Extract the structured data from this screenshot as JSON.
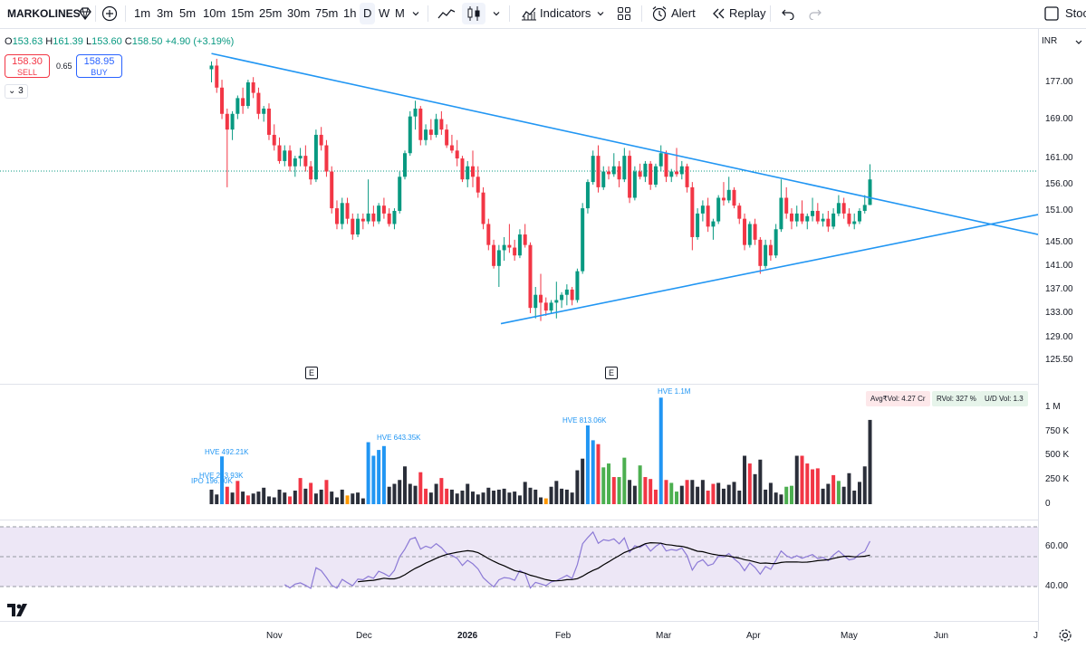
{
  "toolbar": {
    "symbol": "MARKOLINES",
    "timeframes": [
      "1m",
      "3m",
      "5m",
      "10m",
      "15m",
      "25m",
      "30m",
      "75m",
      "1h",
      "D",
      "W",
      "M"
    ],
    "active_timeframe": "D",
    "indicators_label": "Indicators",
    "alert_label": "Alert",
    "replay_label": "Replay",
    "right_label": "Stoc"
  },
  "legend": {
    "o_label": "O",
    "o_value": "153.63",
    "h_label": "H",
    "h_value": "161.39",
    "l_label": "L",
    "l_value": "153.60",
    "c_label": "C",
    "c_value": "158.50",
    "change": "+4.90 (+3.19%)"
  },
  "trade": {
    "sell_price": "158.30",
    "sell_label": "SELL",
    "spread": "0.65",
    "buy_price": "158.95",
    "buy_label": "BUY"
  },
  "indicator_count": "3",
  "currency": "INR",
  "price_axis": {
    "ticks": [
      "177.00",
      "169.00",
      "161.00",
      "156.00",
      "151.00",
      "145.00",
      "141.00",
      "137.00",
      "133.00",
      "129.00",
      "125.50"
    ]
  },
  "volume_axis": {
    "ticks": [
      "1 M",
      "750 K",
      "500 K",
      "250 K",
      "0"
    ]
  },
  "rsi_axis": {
    "ticks": [
      "60.00",
      "40.00"
    ]
  },
  "time_axis": {
    "labels": [
      "Nov",
      "Dec",
      "2026",
      "Feb",
      "Mar",
      "Apr",
      "May",
      "Jun",
      "J"
    ]
  },
  "earnings_marker": "E",
  "volume_tags": {
    "avg": "Avg₹Vol: 4.27 Cr",
    "rvol": "RVol: 327 %",
    "ud": "U/D Vol: 1.3"
  },
  "volume_annotations": [
    "HVE 492.21K",
    "HVE 243.93K",
    "IPO 196.60K",
    "HVE 643.35K",
    "HVE 813.06K",
    "HVE 1.1M"
  ],
  "colors": {
    "up": "#089981",
    "down": "#f23645",
    "trendline": "#2196f3",
    "vol_dark": "#2a2e39",
    "vol_blue": "#2196f3",
    "vol_green": "#4caf50",
    "vol_red": "#f23645",
    "rsi": "#8c7ad6",
    "rsi_ma": "#000000",
    "rsi_band": "#ede7f6"
  },
  "chart_data": {
    "type": "candlestick",
    "instrument": "MARKOLINES",
    "interval": "D",
    "ylim": [
      124,
      183
    ],
    "candles": [
      [
        179.5,
        181.0,
        177.0,
        180.2
      ],
      [
        180.2,
        181.5,
        175.0,
        176.0
      ],
      [
        176.0,
        177.5,
        170.0,
        171.0
      ],
      [
        171.0,
        172.0,
        157.0,
        168.0
      ],
      [
        168.0,
        171.5,
        166.0,
        171.0
      ],
      [
        171.0,
        174.5,
        170.0,
        174.0
      ],
      [
        174.0,
        176.0,
        171.0,
        172.5
      ],
      [
        172.5,
        177.5,
        172.0,
        177.0
      ],
      [
        177.0,
        178.0,
        174.0,
        175.0
      ],
      [
        175.0,
        176.0,
        170.0,
        171.0
      ],
      [
        171.0,
        172.5,
        169.5,
        172.0
      ],
      [
        172.0,
        173.0,
        166.0,
        167.0
      ],
      [
        167.0,
        169.0,
        164.0,
        165.0
      ],
      [
        165.0,
        166.5,
        161.5,
        162.0
      ],
      [
        162.0,
        165.0,
        161.0,
        164.0
      ],
      [
        164.0,
        165.0,
        160.0,
        161.0
      ],
      [
        161.0,
        163.0,
        159.0,
        162.5
      ],
      [
        162.5,
        164.5,
        161.0,
        163.0
      ],
      [
        163.0,
        165.0,
        160.0,
        161.0
      ],
      [
        161.0,
        162.0,
        157.5,
        158.5
      ],
      [
        158.5,
        168.0,
        158.0,
        167.0
      ],
      [
        167.0,
        168.5,
        164.0,
        165.0
      ],
      [
        165.0,
        166.0,
        159.0,
        160.0
      ],
      [
        160.0,
        161.0,
        152.0,
        153.0
      ],
      [
        153.0,
        154.5,
        149.0,
        150.0
      ],
      [
        150.0,
        155.0,
        149.0,
        154.0
      ],
      [
        154.0,
        155.0,
        150.0,
        151.0
      ],
      [
        151.0,
        152.0,
        147.0,
        148.0
      ],
      [
        148.0,
        152.0,
        147.5,
        151.0
      ],
      [
        151.0,
        152.0,
        149.0,
        150.5
      ],
      [
        150.5,
        158.5,
        150.0,
        152.0
      ],
      [
        152.0,
        153.5,
        149.5,
        150.5
      ],
      [
        150.5,
        154.0,
        150.0,
        153.5
      ],
      [
        153.5,
        155.0,
        151.0,
        152.0
      ],
      [
        152.0,
        153.0,
        149.5,
        150.0
      ],
      [
        150.0,
        153.0,
        149.0,
        152.5
      ],
      [
        152.5,
        160.0,
        152.0,
        159.0
      ],
      [
        159.0,
        164.0,
        158.5,
        163.5
      ],
      [
        163.5,
        171.5,
        163.0,
        170.5
      ],
      [
        170.5,
        173.5,
        168.0,
        172.0
      ],
      [
        172.0,
        172.5,
        165.0,
        166.0
      ],
      [
        166.0,
        169.0,
        165.0,
        168.0
      ],
      [
        168.0,
        170.0,
        166.0,
        167.0
      ],
      [
        167.0,
        171.0,
        166.5,
        170.0
      ],
      [
        170.0,
        171.5,
        167.0,
        168.0
      ],
      [
        168.0,
        169.0,
        164.5,
        165.0
      ],
      [
        165.0,
        167.0,
        163.5,
        164.0
      ],
      [
        164.0,
        166.0,
        161.0,
        162.5
      ],
      [
        162.5,
        163.0,
        158.0,
        158.5
      ],
      [
        158.5,
        162.0,
        157.0,
        161.0
      ],
      [
        161.0,
        164.0,
        157.0,
        159.0
      ],
      [
        159.0,
        161.0,
        155.0,
        156.0
      ],
      [
        156.0,
        157.0,
        149.0,
        150.0
      ],
      [
        150.0,
        151.0,
        145.0,
        146.0
      ],
      [
        146.0,
        147.0,
        141.5,
        142.0
      ],
      [
        142.0,
        146.0,
        138.0,
        145.0
      ],
      [
        145.0,
        147.5,
        143.0,
        146.0
      ],
      [
        146.0,
        150.0,
        144.5,
        145.5
      ],
      [
        145.5,
        147.0,
        143.0,
        144.0
      ],
      [
        144.0,
        149.0,
        143.5,
        148.0
      ],
      [
        148.0,
        150.0,
        145.5,
        146.0
      ],
      [
        146.0,
        146.5,
        133.0,
        134.0
      ],
      [
        134.0,
        138.0,
        132.0,
        136.5
      ],
      [
        136.5,
        140.5,
        131.5,
        135.0
      ],
      [
        135.0,
        136.0,
        132.5,
        133.5
      ],
      [
        133.5,
        135.5,
        133.0,
        135.0
      ],
      [
        135.0,
        139.0,
        132.0,
        135.5
      ],
      [
        135.5,
        137.0,
        134.0,
        136.5
      ],
      [
        136.5,
        138.5,
        134.5,
        137.5
      ],
      [
        137.5,
        138.0,
        134.5,
        135.5
      ],
      [
        135.5,
        141.5,
        135.0,
        141.0
      ],
      [
        141.0,
        154.0,
        140.5,
        153.0
      ],
      [
        153.0,
        158.5,
        152.0,
        158.0
      ],
      [
        158.0,
        164.0,
        157.5,
        163.0
      ],
      [
        163.0,
        165.0,
        156.0,
        157.0
      ],
      [
        157.0,
        161.0,
        156.5,
        160.0
      ],
      [
        160.0,
        161.0,
        158.5,
        159.5
      ],
      [
        159.5,
        163.5,
        159.0,
        161.0
      ],
      [
        161.0,
        162.0,
        157.0,
        158.5
      ],
      [
        158.5,
        164.5,
        158.0,
        163.0
      ],
      [
        163.0,
        164.0,
        154.0,
        155.0
      ],
      [
        155.0,
        161.0,
        154.5,
        160.0
      ],
      [
        160.0,
        161.5,
        158.5,
        159.0
      ],
      [
        159.0,
        162.0,
        158.0,
        161.5
      ],
      [
        161.5,
        162.0,
        156.5,
        157.5
      ],
      [
        157.5,
        161.5,
        157.0,
        161.0
      ],
      [
        161.0,
        165.0,
        160.0,
        163.5
      ],
      [
        163.5,
        164.0,
        158.0,
        159.0
      ],
      [
        159.0,
        160.5,
        158.0,
        160.0
      ],
      [
        160.0,
        164.5,
        159.0,
        159.5
      ],
      [
        159.5,
        162.0,
        158.5,
        161.0
      ],
      [
        161.0,
        161.5,
        156.0,
        157.0
      ],
      [
        157.0,
        158.0,
        145.0,
        147.5
      ],
      [
        147.5,
        153.0,
        147.0,
        152.0
      ],
      [
        152.0,
        154.5,
        150.5,
        153.5
      ],
      [
        153.5,
        155.0,
        148.5,
        149.5
      ],
      [
        149.5,
        151.0,
        147.0,
        150.5
      ],
      [
        150.5,
        155.5,
        150.0,
        155.0
      ],
      [
        155.0,
        158.0,
        153.5,
        154.5
      ],
      [
        154.5,
        159.0,
        154.0,
        156.5
      ],
      [
        156.5,
        157.0,
        153.0,
        153.5
      ],
      [
        153.5,
        154.0,
        150.0,
        151.0
      ],
      [
        151.0,
        152.0,
        145.0,
        146.0
      ],
      [
        146.0,
        150.5,
        145.5,
        150.0
      ],
      [
        150.0,
        151.0,
        146.0,
        147.0
      ],
      [
        147.0,
        147.5,
        140.5,
        142.0
      ],
      [
        142.0,
        147.0,
        141.5,
        146.0
      ],
      [
        146.0,
        147.0,
        143.0,
        144.0
      ],
      [
        144.0,
        150.0,
        143.5,
        149.0
      ],
      [
        149.0,
        158.5,
        148.5,
        155.0
      ],
      [
        155.0,
        157.0,
        151.0,
        152.0
      ],
      [
        152.0,
        153.0,
        149.0,
        150.5
      ],
      [
        150.5,
        153.5,
        149.5,
        152.0
      ],
      [
        152.0,
        154.5,
        150.0,
        150.5
      ],
      [
        150.5,
        152.0,
        149.0,
        151.5
      ],
      [
        151.5,
        155.0,
        150.5,
        152.5
      ],
      [
        152.5,
        154.0,
        150.0,
        150.5
      ],
      [
        150.5,
        152.0,
        149.5,
        151.0
      ],
      [
        151.0,
        152.5,
        148.5,
        149.5
      ],
      [
        149.5,
        153.0,
        149.0,
        152.0
      ],
      [
        152.0,
        155.5,
        151.5,
        154.0
      ],
      [
        154.0,
        155.0,
        151.0,
        152.0
      ],
      [
        152.0,
        153.0,
        149.5,
        150.0
      ],
      [
        150.0,
        152.0,
        149.0,
        150.5
      ],
      [
        150.5,
        153.0,
        150.0,
        152.5
      ],
      [
        152.5,
        155.5,
        152.0,
        153.63
      ],
      [
        153.63,
        161.39,
        153.6,
        158.5
      ]
    ],
    "volume_k": [
      150,
      100,
      493,
      180,
      120,
      240,
      130,
      90,
      110,
      130,
      170,
      80,
      70,
      150,
      120,
      80,
      140,
      270,
      160,
      220,
      110,
      150,
      250,
      130,
      70,
      150,
      90,
      110,
      120,
      60,
      640,
      500,
      560,
      600,
      180,
      210,
      250,
      390,
      210,
      190,
      330,
      160,
      120,
      210,
      270,
      160,
      150,
      110,
      140,
      210,
      130,
      100,
      120,
      170,
      140,
      150,
      160,
      120,
      130,
      90,
      230,
      170,
      150,
      70,
      60,
      180,
      240,
      160,
      150,
      120,
      350,
      470,
      813,
      660,
      620,
      380,
      420,
      280,
      280,
      480,
      250,
      190,
      400,
      280,
      260,
      150,
      1100,
      250,
      220,
      130,
      190,
      250,
      250,
      180,
      250,
      140,
      210,
      220,
      160,
      200,
      230,
      140,
      500,
      420,
      310,
      460,
      150,
      220,
      120,
      100,
      180,
      190,
      500,
      500,
      420,
      360,
      370,
      160,
      210,
      300,
      240,
      180,
      320,
      140,
      230,
      390,
      870
    ],
    "volume_colors": "per-bar: dark / blue (high-volume) / green / red / orange",
    "rsi_ylim": [
      25,
      75
    ],
    "rsi_levels": [
      70,
      50,
      30
    ],
    "trendlines": [
      {
        "name": "upper",
        "from": {
          "bar": 0,
          "price": 182.5
        },
        "to": {
          "bar": "right edge",
          "price": 148.0
        }
      },
      {
        "name": "lower",
        "from": {
          "bar": 61,
          "price": 131.0
        },
        "to": {
          "bar": "right edge",
          "price": 151.8
        }
      }
    ]
  }
}
